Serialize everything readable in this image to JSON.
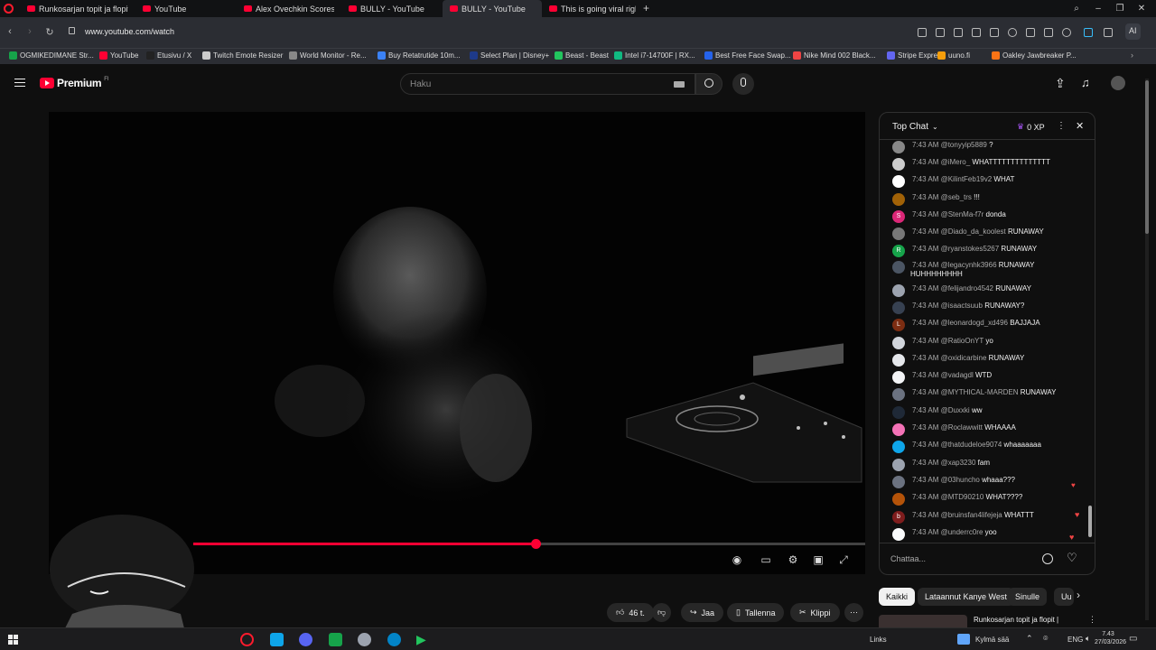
{
  "browser": {
    "tabs": [
      {
        "label": "Runkosarjan topit ja flopit",
        "active": false
      },
      {
        "label": "YouTube",
        "active": false
      },
      {
        "label": "Alex Ovechkin Scores Thre",
        "active": false
      },
      {
        "label": "BULLY - YouTube",
        "active": false
      },
      {
        "label": "BULLY - YouTube",
        "active": true
      },
      {
        "label": "This is going viral right no",
        "active": false
      }
    ],
    "url": "www.youtube.com/watch",
    "ai_button": "AI"
  },
  "bookmarks": [
    {
      "label": "OGMIKEDIMANE Str...",
      "color": "#16a34a"
    },
    {
      "label": "YouTube",
      "color": "#ff0033"
    },
    {
      "label": "Etusivu / X",
      "color": "#222222"
    },
    {
      "label": "Twitch Emote Resizer",
      "color": "#cccccc"
    },
    {
      "label": "World Monitor - Re...",
      "color": "#888888"
    },
    {
      "label": "Buy Retatrutide 10m...",
      "color": "#3b82f6"
    },
    {
      "label": "Select Plan | Disney+",
      "color": "#1e3a8a"
    },
    {
      "label": "Beast - Beast",
      "color": "#22c55e"
    },
    {
      "label": "Intel i7-14700F | RX...",
      "color": "#10b981"
    },
    {
      "label": "Best Free Face Swap...",
      "color": "#2563eb"
    },
    {
      "label": "Nike Mind 002 Black...",
      "color": "#ef4444"
    },
    {
      "label": "Stripe Express",
      "color": "#6366f1"
    },
    {
      "label": "uuno.fi",
      "color": "#f59e0b"
    },
    {
      "label": "Oakley Jawbreaker P...",
      "color": "#f97316"
    }
  ],
  "header": {
    "logo_text": "Premium",
    "logo_suffix": "FI",
    "search_placeholder": "Haku"
  },
  "video": {
    "progress": 0.51
  },
  "chat": {
    "title": "Top Chat",
    "xp": "0 XP",
    "input_placeholder": "Chattaa...",
    "messages": [
      {
        "time": "7:43 AM",
        "user": "@tonyyip5889",
        "text": "?",
        "avatar_color": "#888888",
        "avatar_letter": ""
      },
      {
        "time": "7:43 AM",
        "user": "@iMero_",
        "text": "WHATTTTTTTTTTTTTT",
        "avatar_color": "#cccccc",
        "avatar_letter": ""
      },
      {
        "time": "7:43 AM",
        "user": "@KilintFeb19v2",
        "text": "WHAT",
        "avatar_color": "#ffffff",
        "avatar_letter": ""
      },
      {
        "time": "7:43 AM",
        "user": "@seb_trs",
        "text": "!!!",
        "avatar_color": "#a16207",
        "avatar_letter": ""
      },
      {
        "time": "7:43 AM",
        "user": "@StenMa-f7r",
        "text": "donda",
        "avatar_color": "#db2777",
        "avatar_letter": "S"
      },
      {
        "time": "7:43 AM",
        "user": "@Diado_da_koolest",
        "text": "RUNAWAY",
        "avatar_color": "#777777",
        "avatar_letter": ""
      },
      {
        "time": "7:43 AM",
        "user": "@ryanstokes5267",
        "text": "RUNAWAY",
        "avatar_color": "#16a34a",
        "avatar_letter": "R"
      },
      {
        "time": "7:43 AM",
        "user": "@legacynhk3966",
        "text": "RUNAWAY HUHHHHHHHH",
        "avatar_color": "#4b5563",
        "avatar_letter": ""
      },
      {
        "time": "7:43 AM",
        "user": "@felijandro4542",
        "text": "RUNAWAY",
        "avatar_color": "#9ca3af",
        "avatar_letter": ""
      },
      {
        "time": "7:43 AM",
        "user": "@isaactsuub",
        "text": "RUNAWAY?",
        "avatar_color": "#374151",
        "avatar_letter": ""
      },
      {
        "time": "7:43 AM",
        "user": "@leonardogd_xd496",
        "text": "BAJJAJA",
        "avatar_color": "#7c2d12",
        "avatar_letter": "L"
      },
      {
        "time": "7:43 AM",
        "user": "@RatioOnYT",
        "text": "yo",
        "avatar_color": "#d1d5db",
        "avatar_letter": ""
      },
      {
        "time": "7:43 AM",
        "user": "@oxidicarbine",
        "text": "RUNAWAY",
        "avatar_color": "#e5e7eb",
        "avatar_letter": ""
      },
      {
        "time": "7:43 AM",
        "user": "@vadagdl",
        "text": "WTD",
        "avatar_color": "#f3f4f6",
        "avatar_letter": ""
      },
      {
        "time": "7:43 AM",
        "user": "@MYTHICAL-MARDEN",
        "text": "RUNAWAY",
        "avatar_color": "#6b7280",
        "avatar_letter": ""
      },
      {
        "time": "7:43 AM",
        "user": "@Duxxki",
        "text": "ww",
        "avatar_color": "#1f2937",
        "avatar_letter": ""
      },
      {
        "time": "7:43 AM",
        "user": "@Roclawwitt",
        "text": "WHAAAA",
        "avatar_color": "#f472b6",
        "avatar_letter": ""
      },
      {
        "time": "7:43 AM",
        "user": "@thatdudeloe9074",
        "text": "whaaaaaaa",
        "avatar_color": "#0ea5e9",
        "avatar_letter": ""
      },
      {
        "time": "7:43 AM",
        "user": "@xap3230",
        "text": "fam",
        "avatar_color": "#9ca3af",
        "avatar_letter": ""
      },
      {
        "time": "7:43 AM",
        "user": "@03huncho",
        "text": "whaaa???",
        "avatar_color": "#6b7280",
        "avatar_letter": ""
      },
      {
        "time": "7:43 AM",
        "user": "@MTD90210",
        "text": "WHAT????",
        "avatar_color": "#b45309",
        "avatar_letter": ""
      },
      {
        "time": "7:43 AM",
        "user": "@bruinsfan4lifejeja",
        "text": "WHATTT",
        "avatar_color": "#7f1d1d",
        "avatar_letter": "b"
      },
      {
        "time": "7:43 AM",
        "user": "@underrc0re",
        "text": "yoo",
        "avatar_color": "#f9fafb",
        "avatar_letter": ""
      }
    ]
  },
  "actions": {
    "likes": "46 t.",
    "share": "Jaa",
    "save": "Tallenna",
    "clip": "Klippi"
  },
  "chips": [
    "Kaikki",
    "Lataannut Kanye West",
    "Sinulle",
    "Uu"
  ],
  "related": {
    "title": "Runkosarjan topit ja flopit |"
  },
  "taskbar": {
    "links": "Links",
    "weather": "Kylmä sää",
    "lang": "ENG",
    "time": "7.43",
    "date": "27/03/2026"
  }
}
